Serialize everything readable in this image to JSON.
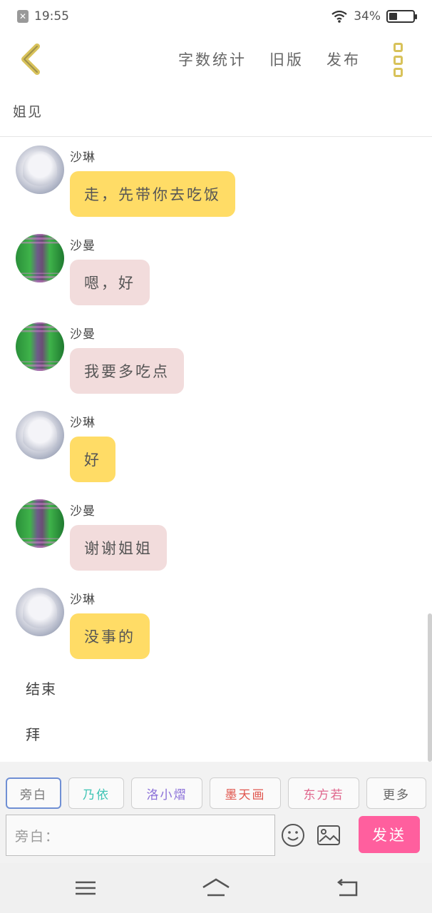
{
  "status_bar": {
    "time": "19:55",
    "battery_text": "34%",
    "battery_level": 0.34,
    "icons": [
      "close-notification-icon",
      "wifi-icon",
      "battery-icon"
    ]
  },
  "toolbar": {
    "links": [
      "字数统计",
      "旧版",
      "发布"
    ],
    "accent": "#d8c25a"
  },
  "subtitle": "姐见",
  "messages": [
    {
      "sender": "沙琳",
      "text": "走，先带你去吃饭",
      "avatar": "linn",
      "bubble_color": "#ffdc66"
    },
    {
      "sender": "沙曼",
      "text": "嗯，好",
      "avatar": "man",
      "bubble_color": "#f2dcdc"
    },
    {
      "sender": "沙曼",
      "text": "我要多吃点",
      "avatar": "man",
      "bubble_color": "#f2dcdc"
    },
    {
      "sender": "沙琳",
      "text": "好",
      "avatar": "linn",
      "bubble_color": "#ffdc66"
    },
    {
      "sender": "沙曼",
      "text": "谢谢姐姐",
      "avatar": "man",
      "bubble_color": "#f2dcdc"
    },
    {
      "sender": "沙琳",
      "text": "没事的",
      "avatar": "linn",
      "bubble_color": "#ffdc66"
    }
  ],
  "plain_lines": [
    "结束",
    "拜"
  ],
  "chips": [
    {
      "label": "旁白",
      "color": "#777777"
    },
    {
      "label": "乃依",
      "color": "#3fc4b5"
    },
    {
      "label": "洛小熠",
      "color": "#8a6fd8"
    },
    {
      "label": "墨天画",
      "color": "#e0574f"
    },
    {
      "label": "东方若",
      "color": "#e0688e"
    },
    {
      "label": "更多",
      "color": "#666666"
    }
  ],
  "input": {
    "placeholder": "旁白："
  },
  "send_button": {
    "label": "发送",
    "color": "#ff5f9e"
  }
}
